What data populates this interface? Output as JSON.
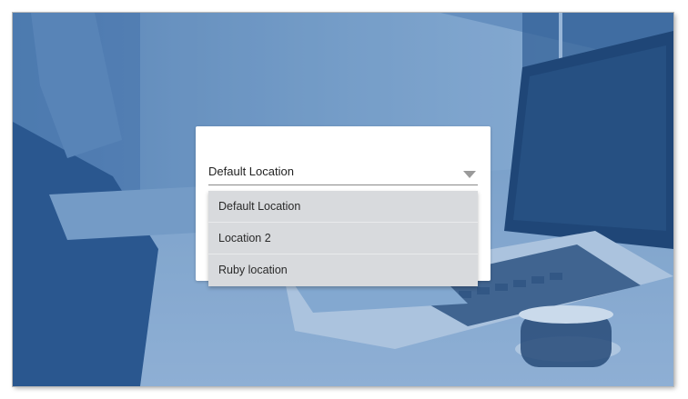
{
  "modal": {
    "select": {
      "selected_value": "Default Location",
      "options": [
        "Default Location",
        "Location 2",
        "Ruby location"
      ]
    }
  },
  "colors": {
    "overlay_blue": "#4f7fb8",
    "dropdown_bg": "#d8dadd",
    "modal_bg": "#ffffff"
  },
  "icons": {
    "dropdown_arrow": "chevron-down-icon"
  }
}
